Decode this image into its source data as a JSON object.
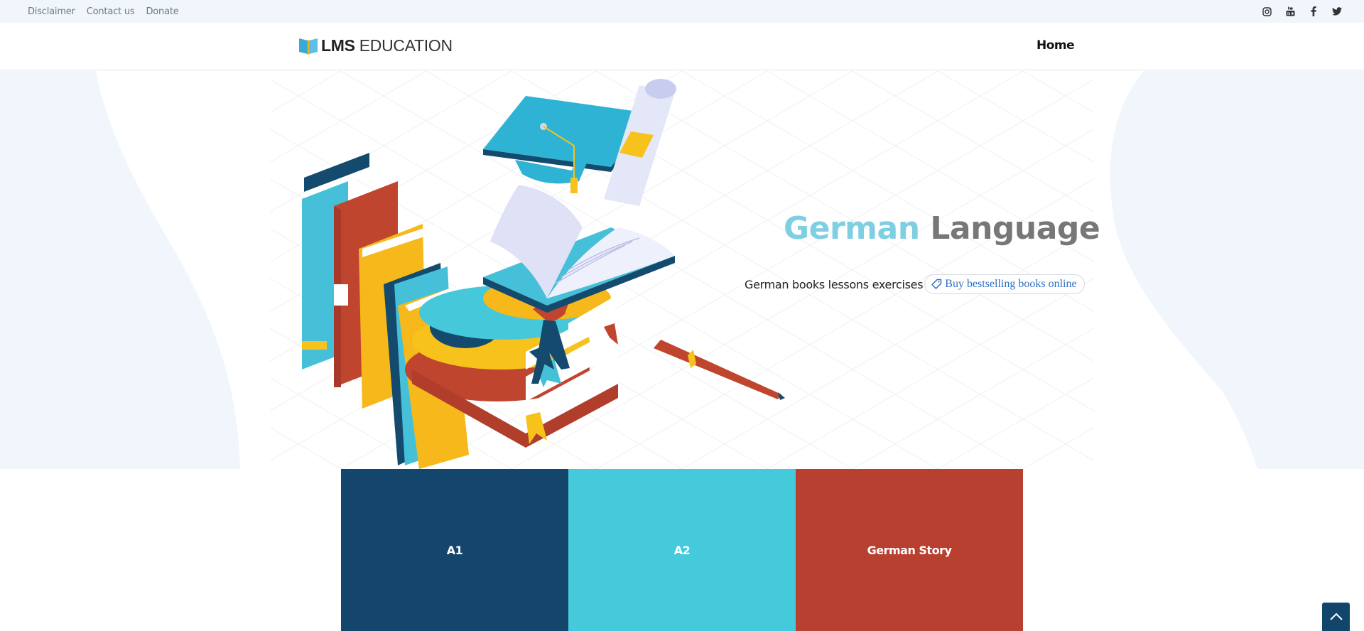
{
  "topbar": {
    "links": [
      {
        "label": "Disclaimer"
      },
      {
        "label": "Contact us"
      },
      {
        "label": "Donate"
      }
    ],
    "social": [
      {
        "icon": "instagram-icon"
      },
      {
        "icon": "youtube-icon"
      },
      {
        "icon": "facebook-icon"
      },
      {
        "icon": "twitter-icon"
      }
    ]
  },
  "navbar": {
    "logo_bold": "LMS",
    "logo_rest": " EDUCATION",
    "home_label": "Home"
  },
  "hero": {
    "title_part1": "German",
    "title_part2": " Language",
    "subtitle": "German books lessons exercises",
    "cta_label": "Buy bestselling books online",
    "cta_icon": "tag-icon",
    "illustration": "books-graduation-cap-illustration"
  },
  "cards": [
    {
      "label": "A1",
      "color": "#13466a"
    },
    {
      "label": "A2",
      "color": "#45cadc"
    },
    {
      "label": "German Story",
      "color": "#b84030"
    }
  ],
  "scroll_top": {
    "icon": "chevron-up-icon"
  },
  "colors": {
    "accent_blue": "#7fcfe2",
    "title_gray": "#777777",
    "link_blue": "#2f6fc0",
    "topbar_bg": "#f1f6fc"
  }
}
